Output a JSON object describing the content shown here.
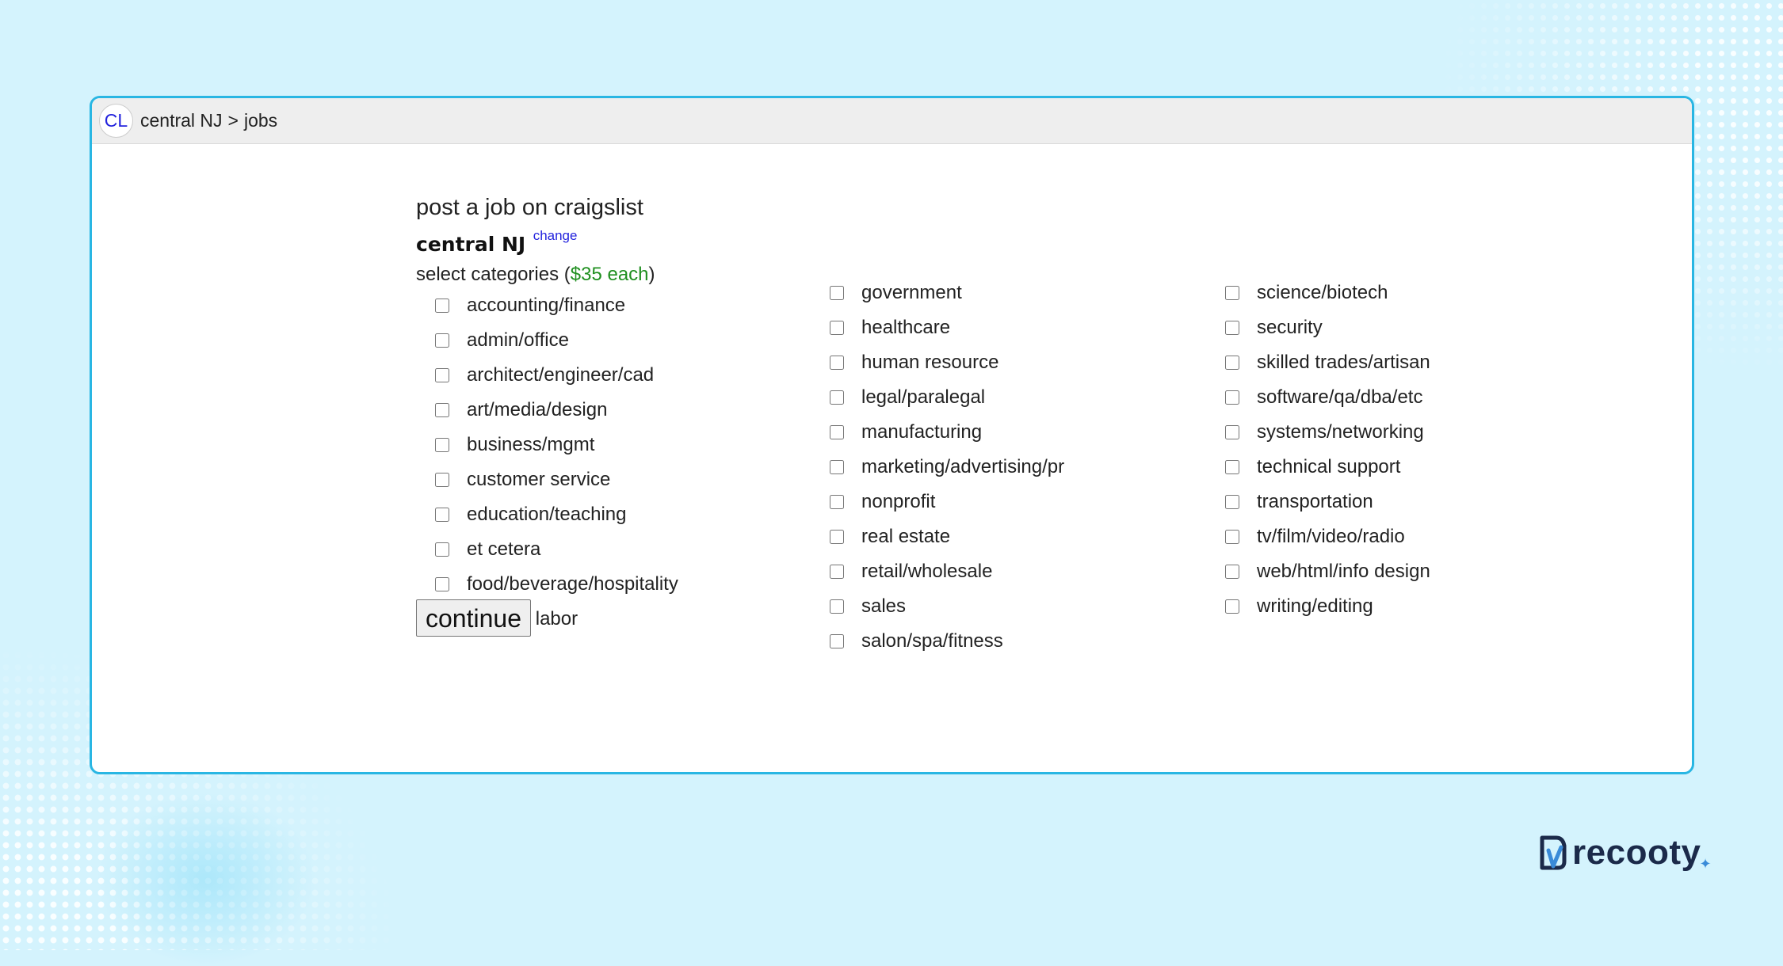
{
  "window": {
    "logo": "CL",
    "breadcrumb": {
      "region": "central NJ",
      "separator": ">",
      "section": "jobs"
    }
  },
  "form": {
    "title": "post a job on craigslist",
    "area": "central NJ",
    "change_link": "change",
    "select_label_prefix": "select categories (",
    "price": "$35 each",
    "select_label_suffix": ")",
    "columns": [
      [
        "accounting/finance",
        "admin/office",
        "architect/engineer/cad",
        "art/media/design",
        "business/mgmt",
        "customer service",
        "education/teaching",
        "et cetera",
        "food/beverage/hospitality",
        "general labor"
      ],
      [
        "government",
        "healthcare",
        "human resource",
        "legal/paralegal",
        "manufacturing",
        "marketing/advertising/pr",
        "nonprofit",
        "real estate",
        "retail/wholesale",
        "sales",
        "salon/spa/fitness"
      ],
      [
        "science/biotech",
        "security",
        "skilled trades/artisan",
        "software/qa/dba/etc",
        "systems/networking",
        "technical support",
        "transportation",
        "tv/film/video/radio",
        "web/html/info design",
        "writing/editing"
      ]
    ],
    "continue_label": "continue"
  },
  "brand": {
    "name": "recooty",
    "icon": "document-check-icon"
  },
  "colors": {
    "page_background": "#d4f3fd",
    "window_border": "#29b6e3",
    "link": "#2323dd",
    "price": "#1f8f1f",
    "brand_text": "#1b2a4a"
  }
}
